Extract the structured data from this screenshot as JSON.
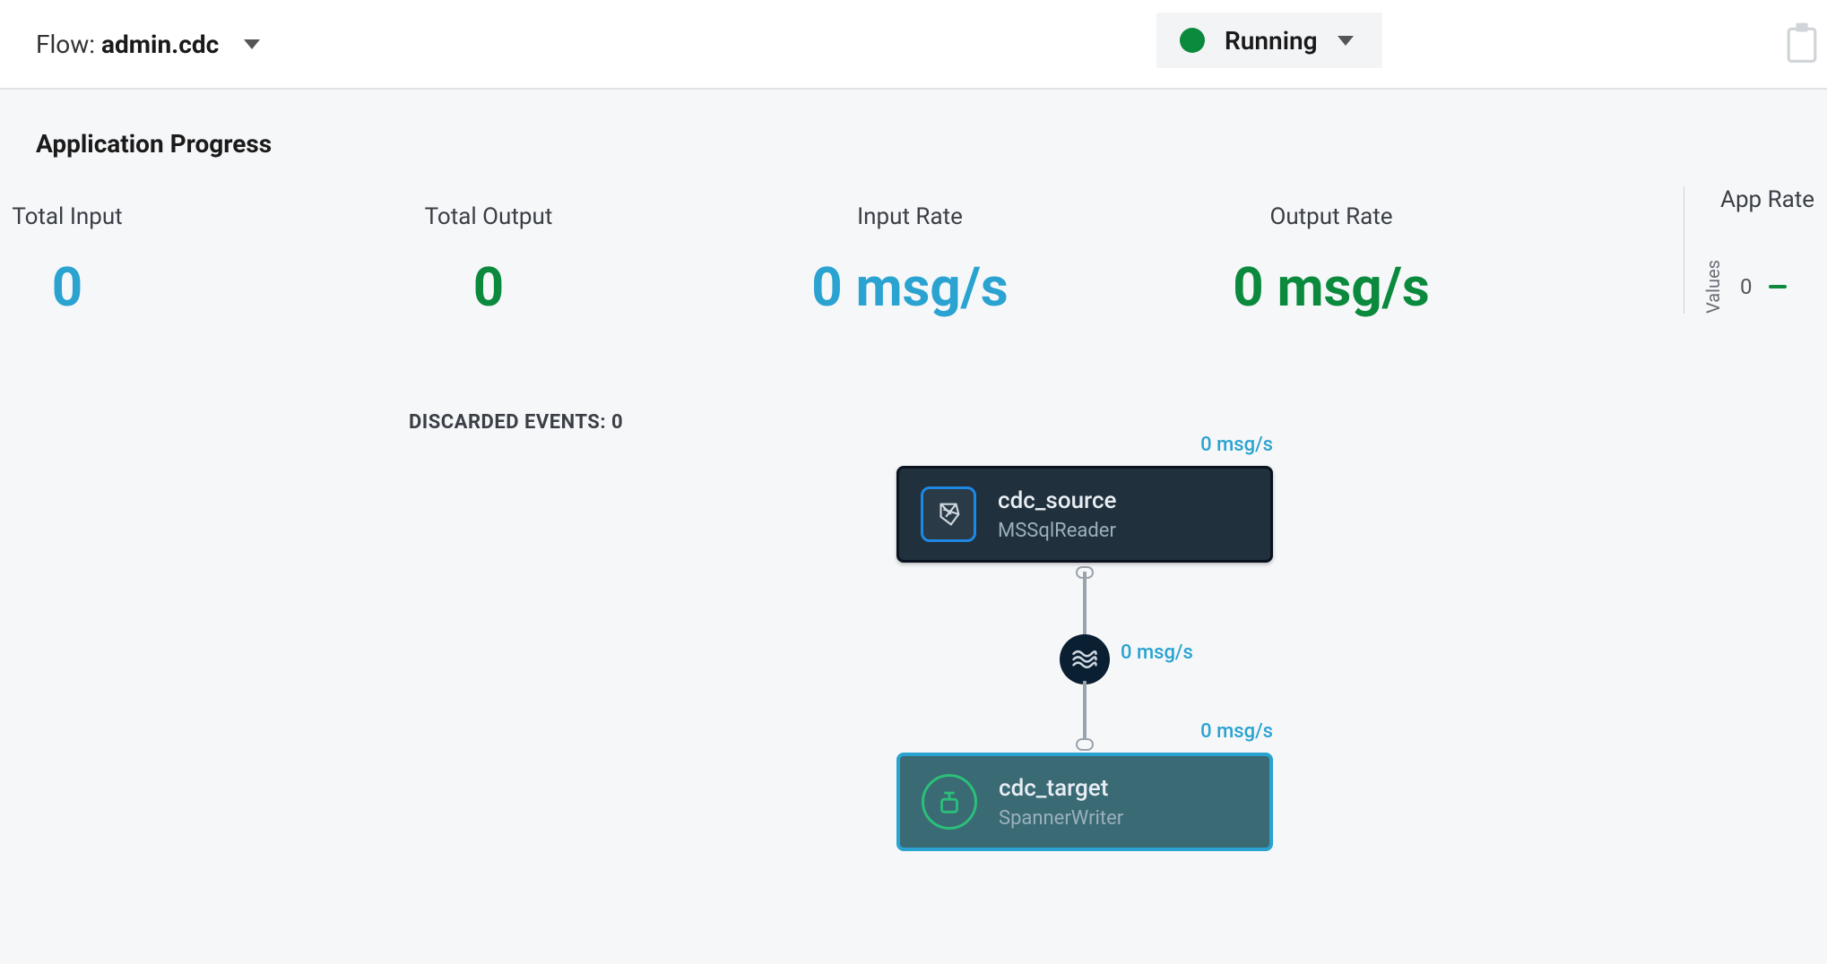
{
  "header": {
    "flow_label": "Flow: ",
    "flow_name": "admin.cdc",
    "status": "Running"
  },
  "section_title": "Application Progress",
  "metrics": {
    "total_input": {
      "label": "Total Input",
      "value": "0"
    },
    "total_output": {
      "label": "Total Output",
      "value": "0"
    },
    "input_rate": {
      "label": "Input Rate",
      "value": "0 msg/s"
    },
    "output_rate": {
      "label": "Output Rate",
      "value": "0 msg/s"
    }
  },
  "discarded_events": "Discarded events: 0",
  "app_rate": {
    "title": "App Rate",
    "axis": "Values",
    "value": "0"
  },
  "diagram": {
    "rate_top": "0 msg/s",
    "rate_mid": "0 msg/s",
    "rate_bottom": "0 msg/s",
    "source": {
      "title": "cdc_source",
      "subtitle": "MSSqlReader"
    },
    "target": {
      "title": "cdc_target",
      "subtitle": "SpannerWriter"
    }
  }
}
